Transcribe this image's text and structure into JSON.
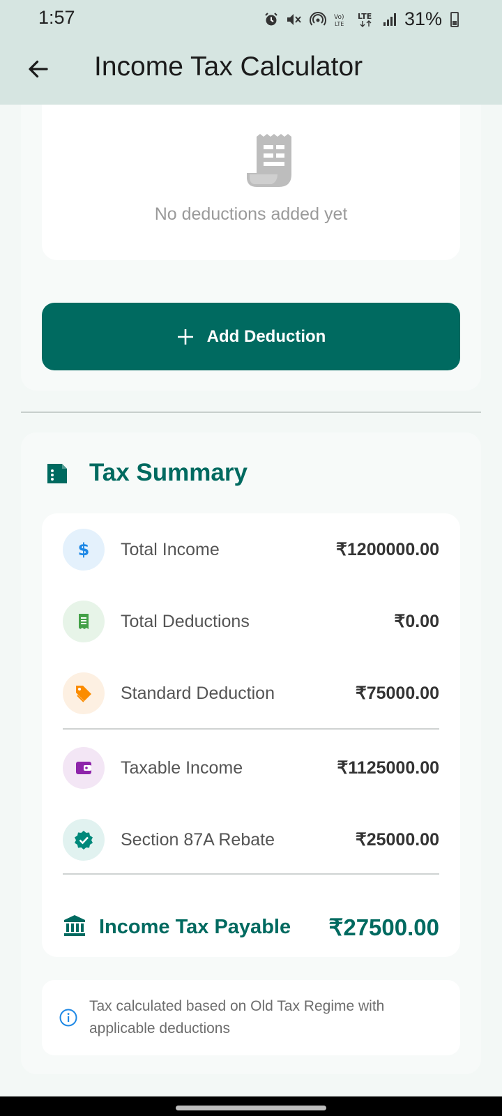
{
  "status_bar": {
    "time": "1:57",
    "network": "LTE",
    "battery_percent": "31%",
    "icons": [
      "alarm-icon",
      "mute-icon",
      "hotspot-icon",
      "volte-icon",
      "lte-icon",
      "signal-icon",
      "battery-icon"
    ]
  },
  "app_bar": {
    "title": "Income Tax Calculator",
    "back_icon": "arrow-left-icon",
    "color": "#d6e5e1"
  },
  "deductions": {
    "empty_icon": "receipt-icon",
    "empty_text": "No deductions added yet",
    "add_button_label": "Add Deduction",
    "add_button_color": "#006a60"
  },
  "summary": {
    "title": "Tax Summary",
    "header_icon": "summary-document-icon",
    "accent_color": "#006a60",
    "rows": [
      {
        "label": "Total Income",
        "value": "₹1200000.00",
        "icon": "dollar-icon",
        "icon_color": "#1e88e5",
        "icon_bg": "#e4f1fc"
      },
      {
        "label": "Total Deductions",
        "value": "₹0.00",
        "icon": "receipt-icon",
        "icon_color": "#43a047",
        "icon_bg": "#e7f4e8"
      },
      {
        "label": "Standard Deduction",
        "value": "₹75000.00",
        "icon": "tag-icon",
        "icon_color": "#fb8c00",
        "icon_bg": "#fdf0e2"
      },
      {
        "label": "Taxable Income",
        "value": "₹1125000.00",
        "icon": "wallet-icon",
        "icon_color": "#8e24aa",
        "icon_bg": "#f3e6f5"
      },
      {
        "label": "Section 87A Rebate",
        "value": "₹25000.00",
        "icon": "verified-icon",
        "icon_color": "#00897b",
        "icon_bg": "#e1f2f0"
      }
    ],
    "payable_label": "Income Tax Payable",
    "payable_value": "₹27500.00",
    "payable_icon": "bank-icon"
  },
  "info": {
    "icon": "info-icon",
    "text": "Tax calculated based on Old Tax Regime with applicable deductions"
  }
}
